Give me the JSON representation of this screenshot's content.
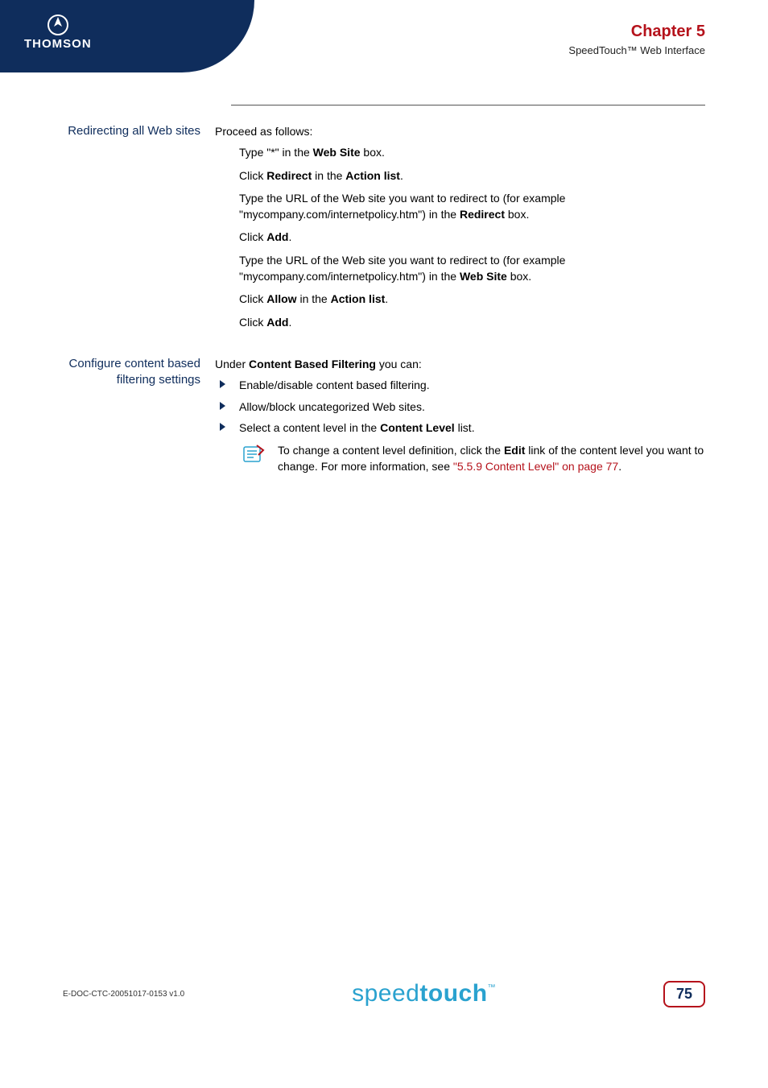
{
  "header": {
    "brand": "THOMSON",
    "chapter_title": "Chapter 5",
    "chapter_sub": "SpeedTouch™ Web Interface"
  },
  "section1": {
    "label": "Redirecting all Web sites",
    "intro": "Proceed as follows:",
    "steps": {
      "s1_pre": "Type \"*\" in the ",
      "s1_bold": "Web Site",
      "s1_post": " box.",
      "s2_pre": "Click ",
      "s2_b1": "Redirect",
      "s2_mid": " in the ",
      "s2_b2": "Action list",
      "s2_post": ".",
      "s3_pre": "Type the URL of the Web site you want to redirect to (for example \"mycompany.com/internetpolicy.htm\") in the ",
      "s3_bold": "Redirect",
      "s3_post": " box.",
      "s4_pre": "Click ",
      "s4_bold": "Add",
      "s4_post": ".",
      "s5_pre": "Type the URL of the Web site you want to redirect to (for example \"mycompany.com/internetpolicy.htm\") in the ",
      "s5_bold": "Web Site",
      "s5_post": " box.",
      "s6_pre": "Click ",
      "s6_b1": "Allow",
      "s6_mid": " in the ",
      "s6_b2": "Action list",
      "s6_post": ".",
      "s7_pre": "Click ",
      "s7_bold": "Add",
      "s7_post": "."
    }
  },
  "section2": {
    "label": "Configure content based filtering settings",
    "intro_pre": "Under ",
    "intro_bold": "Content Based Filtering",
    "intro_post": " you can:",
    "bullets": {
      "b1": "Enable/disable content based filtering.",
      "b2": "Allow/block uncategorized Web sites.",
      "b3_pre": "Select a content level in the ",
      "b3_bold": "Content Level",
      "b3_post": " list."
    },
    "note": {
      "pre": "To change a content level definition, click the ",
      "bold": "Edit",
      "mid": " link of the content level you want to change. For more information, see ",
      "link": "\"5.5.9 Content Level\" on page 77",
      "post": "."
    }
  },
  "footer": {
    "doc_code": "E-DOC-CTC-20051017-0153 v1.0",
    "logo_light": "speed",
    "logo_bold": "touch",
    "logo_tm": "™",
    "page_num": "75"
  }
}
